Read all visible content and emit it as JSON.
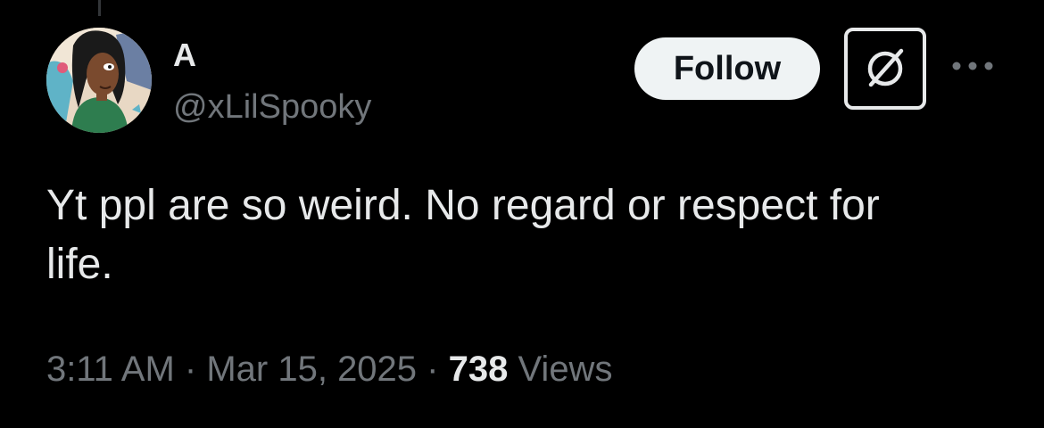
{
  "tweet": {
    "author": {
      "display_name": "A",
      "handle": "@xLilSpooky",
      "avatar_icon": "avatar-cartoon-woman"
    },
    "follow_label": "Follow",
    "grok_icon": "grok-icon",
    "more_icon": "more-dots-icon",
    "text": "Yt ppl are so weird. No regard or respect for\nlife.",
    "time": "3:11 AM",
    "separator": " · ",
    "date": "Mar 15, 2025",
    "views_count": "738",
    "views_label": "Views"
  },
  "colors": {
    "background": "#000000",
    "primary_text": "#e7e9ea",
    "secondary_text": "#71767b",
    "follow_bg": "#eff3f4",
    "follow_text": "#0f1419"
  }
}
